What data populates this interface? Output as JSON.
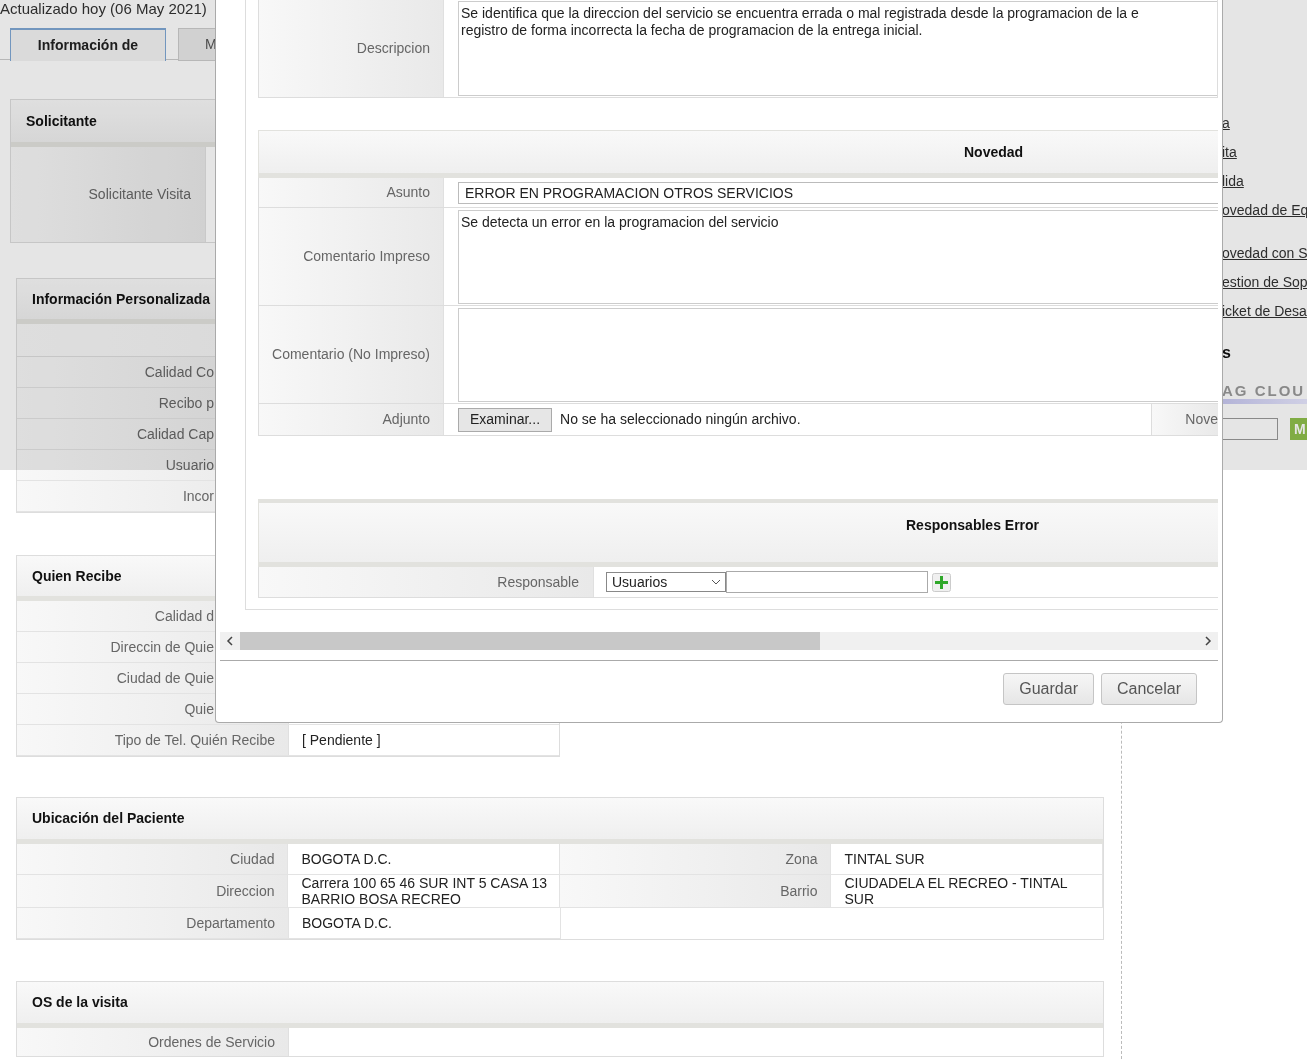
{
  "header_note": "Actualizado hoy (06 May 2021)",
  "tabs": [
    {
      "label": "Información de",
      "selected": true
    },
    {
      "label": "M",
      "selected": false
    }
  ],
  "solicitante": {
    "title": "Solicitante",
    "label": "Solicitante Visita"
  },
  "sections": [
    {
      "title": "Información Personalizada",
      "rows": [
        {
          "kind": "blank"
        },
        {
          "kind": "field",
          "label": "Calidad Co"
        },
        {
          "kind": "field",
          "label": "Recibo p"
        },
        {
          "kind": "field",
          "label": "Calidad Cap"
        },
        {
          "kind": "field",
          "label": "Usuario"
        },
        {
          "kind": "field",
          "label": "Incor"
        }
      ]
    },
    {
      "title": "Quien Recibe",
      "rows": [
        {
          "kind": "field",
          "label": "Calidad d"
        },
        {
          "kind": "field",
          "label": "Direccin de Quie"
        },
        {
          "kind": "field",
          "label": "Ciudad de Quie"
        },
        {
          "kind": "field",
          "label": "Quie"
        },
        {
          "kind": "field",
          "label": "Tipo de Tel. Quién Recibe",
          "value": "[ Pendiente ]"
        }
      ]
    }
  ],
  "ubicacion": {
    "title": "Ubicación del Paciente",
    "rows": [
      [
        {
          "label": "Ciudad",
          "value": "BOGOTA D.C."
        },
        {
          "label": "Zona",
          "value": "TINTAL SUR"
        }
      ],
      [
        {
          "label": "Direccion",
          "value": "Carrera 100 65 46 SUR INT 5 CASA 13 BARRIO BOSA RECREO"
        },
        {
          "label": "Barrio",
          "value": "CIUDADELA EL RECREO - TINTAL SUR"
        }
      ],
      [
        {
          "label": "Departamento",
          "value": "BOGOTA D.C."
        }
      ]
    ]
  },
  "os_visita": {
    "title": "OS de la visita",
    "label": "Ordenes de Servicio"
  },
  "sidebar": {
    "link_groups": [
      [
        "a",
        "ita",
        "lida",
        "ovedad de Eq"
      ],
      [
        "ovedad con S",
        "estion de Sop",
        "icket de Desa"
      ]
    ],
    "heading": "s",
    "logo": "AG CLOU",
    "button": "M"
  },
  "dialog": {
    "descripcion": {
      "label": "Descripcion",
      "value": "Se identifica que la direccion del servicio se encuentra errada o mal registrada desde la programacion de la e\nregistro de forma incorrecta la fecha de programacion de la entrega inicial."
    },
    "novedad": {
      "title": "Novedad",
      "asunto": {
        "label": "Asunto",
        "value": "ERROR EN PROGRAMACION OTROS SERVICIOS"
      },
      "comentario_impreso": {
        "label": "Comentario Impreso",
        "value": "Se detecta un error en la programacion del servicio"
      },
      "comentario_no_impreso": {
        "label": "Comentario (No Impreso)"
      },
      "adjunto": {
        "label": "Adjunto",
        "button": "Examinar...",
        "status": "No se ha seleccionado ningún archivo.",
        "next_label": "Nove"
      }
    },
    "responsables": {
      "title": "Responsables Error",
      "label": "Responsable",
      "select": "Usuarios"
    },
    "buttons": [
      "Guardar",
      "Cancelar"
    ]
  }
}
